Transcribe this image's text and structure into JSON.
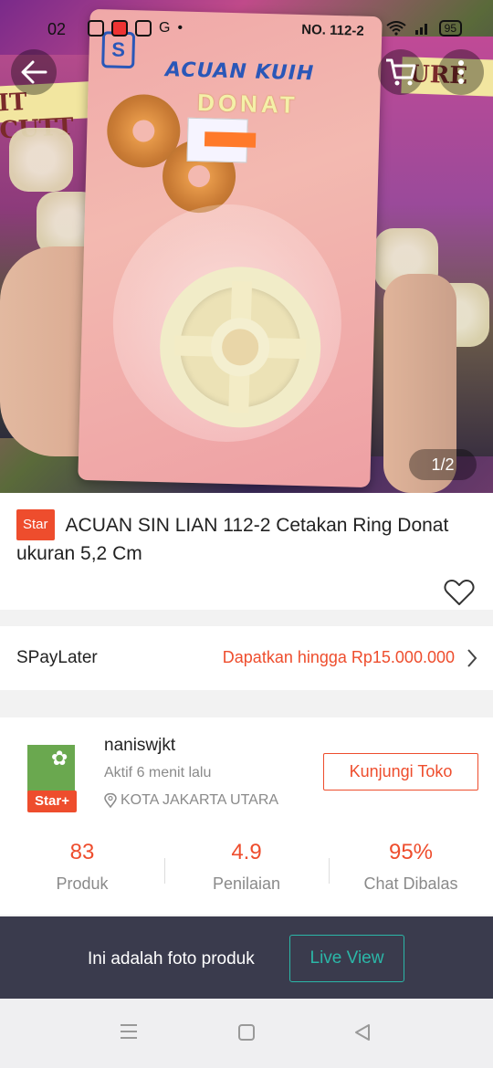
{
  "status_bar": {
    "time": "02",
    "battery": "95"
  },
  "hero": {
    "image_counter": "1/2",
    "card_number": "NO. 112-2",
    "card_brand": "ACUAN KUIH",
    "card_product": "DONAT"
  },
  "product": {
    "badge": "Star",
    "title": "ACUAN SIN LIAN 112-2 Cetakan Ring Donat ukuran 5,2 Cm"
  },
  "spaylater": {
    "label": "SPayLater",
    "value": "Dapatkan hingga Rp15.000.000"
  },
  "shop": {
    "name": "naniswjkt",
    "active": "Aktif 6 menit lalu",
    "location": "KOTA JAKARTA UTARA",
    "badge": "Star+",
    "visit_label": "Kunjungi Toko",
    "stats": [
      {
        "value": "83",
        "label": "Produk"
      },
      {
        "value": "4.9",
        "label": "Penilaian"
      },
      {
        "value": "95%",
        "label": "Chat Dibalas"
      }
    ]
  },
  "photo_bar": {
    "text": "Ini adalah foto produk",
    "button": "Live View"
  },
  "colors": {
    "accent": "#ee4d2d",
    "teal": "#2bb7a8",
    "dark_bar": "#3a3b4d"
  },
  "icons": [
    "back-arrow-icon",
    "cart-icon",
    "more-vertical-icon",
    "heart-icon",
    "chevron-right-icon",
    "location-pin-icon",
    "menu-icon",
    "home-square-icon",
    "back-triangle-icon"
  ]
}
